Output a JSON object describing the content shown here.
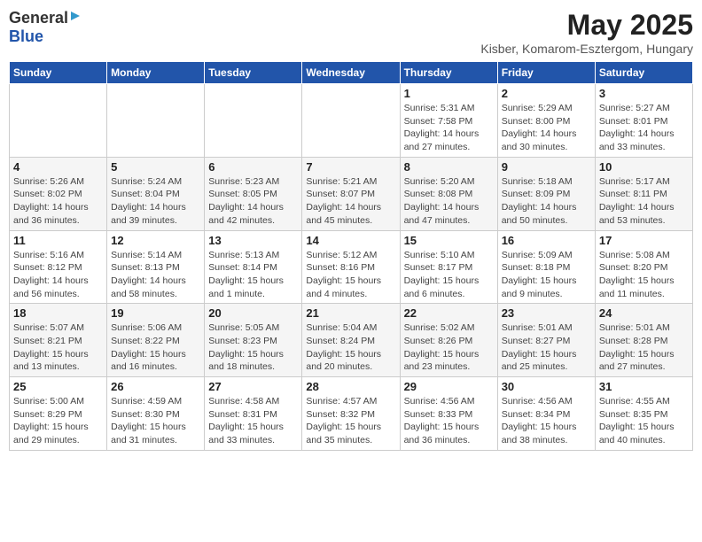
{
  "header": {
    "logo_general": "General",
    "logo_blue": "Blue",
    "title": "May 2025",
    "subtitle": "Kisber, Komarom-Esztergom, Hungary"
  },
  "calendar": {
    "days_of_week": [
      "Sunday",
      "Monday",
      "Tuesday",
      "Wednesday",
      "Thursday",
      "Friday",
      "Saturday"
    ],
    "weeks": [
      [
        {
          "day": "",
          "info": ""
        },
        {
          "day": "",
          "info": ""
        },
        {
          "day": "",
          "info": ""
        },
        {
          "day": "",
          "info": ""
        },
        {
          "day": "1",
          "info": "Sunrise: 5:31 AM\nSunset: 7:58 PM\nDaylight: 14 hours\nand 27 minutes."
        },
        {
          "day": "2",
          "info": "Sunrise: 5:29 AM\nSunset: 8:00 PM\nDaylight: 14 hours\nand 30 minutes."
        },
        {
          "day": "3",
          "info": "Sunrise: 5:27 AM\nSunset: 8:01 PM\nDaylight: 14 hours\nand 33 minutes."
        }
      ],
      [
        {
          "day": "4",
          "info": "Sunrise: 5:26 AM\nSunset: 8:02 PM\nDaylight: 14 hours\nand 36 minutes."
        },
        {
          "day": "5",
          "info": "Sunrise: 5:24 AM\nSunset: 8:04 PM\nDaylight: 14 hours\nand 39 minutes."
        },
        {
          "day": "6",
          "info": "Sunrise: 5:23 AM\nSunset: 8:05 PM\nDaylight: 14 hours\nand 42 minutes."
        },
        {
          "day": "7",
          "info": "Sunrise: 5:21 AM\nSunset: 8:07 PM\nDaylight: 14 hours\nand 45 minutes."
        },
        {
          "day": "8",
          "info": "Sunrise: 5:20 AM\nSunset: 8:08 PM\nDaylight: 14 hours\nand 47 minutes."
        },
        {
          "day": "9",
          "info": "Sunrise: 5:18 AM\nSunset: 8:09 PM\nDaylight: 14 hours\nand 50 minutes."
        },
        {
          "day": "10",
          "info": "Sunrise: 5:17 AM\nSunset: 8:11 PM\nDaylight: 14 hours\nand 53 minutes."
        }
      ],
      [
        {
          "day": "11",
          "info": "Sunrise: 5:16 AM\nSunset: 8:12 PM\nDaylight: 14 hours\nand 56 minutes."
        },
        {
          "day": "12",
          "info": "Sunrise: 5:14 AM\nSunset: 8:13 PM\nDaylight: 14 hours\nand 58 minutes."
        },
        {
          "day": "13",
          "info": "Sunrise: 5:13 AM\nSunset: 8:14 PM\nDaylight: 15 hours\nand 1 minute."
        },
        {
          "day": "14",
          "info": "Sunrise: 5:12 AM\nSunset: 8:16 PM\nDaylight: 15 hours\nand 4 minutes."
        },
        {
          "day": "15",
          "info": "Sunrise: 5:10 AM\nSunset: 8:17 PM\nDaylight: 15 hours\nand 6 minutes."
        },
        {
          "day": "16",
          "info": "Sunrise: 5:09 AM\nSunset: 8:18 PM\nDaylight: 15 hours\nand 9 minutes."
        },
        {
          "day": "17",
          "info": "Sunrise: 5:08 AM\nSunset: 8:20 PM\nDaylight: 15 hours\nand 11 minutes."
        }
      ],
      [
        {
          "day": "18",
          "info": "Sunrise: 5:07 AM\nSunset: 8:21 PM\nDaylight: 15 hours\nand 13 minutes."
        },
        {
          "day": "19",
          "info": "Sunrise: 5:06 AM\nSunset: 8:22 PM\nDaylight: 15 hours\nand 16 minutes."
        },
        {
          "day": "20",
          "info": "Sunrise: 5:05 AM\nSunset: 8:23 PM\nDaylight: 15 hours\nand 18 minutes."
        },
        {
          "day": "21",
          "info": "Sunrise: 5:04 AM\nSunset: 8:24 PM\nDaylight: 15 hours\nand 20 minutes."
        },
        {
          "day": "22",
          "info": "Sunrise: 5:02 AM\nSunset: 8:26 PM\nDaylight: 15 hours\nand 23 minutes."
        },
        {
          "day": "23",
          "info": "Sunrise: 5:01 AM\nSunset: 8:27 PM\nDaylight: 15 hours\nand 25 minutes."
        },
        {
          "day": "24",
          "info": "Sunrise: 5:01 AM\nSunset: 8:28 PM\nDaylight: 15 hours\nand 27 minutes."
        }
      ],
      [
        {
          "day": "25",
          "info": "Sunrise: 5:00 AM\nSunset: 8:29 PM\nDaylight: 15 hours\nand 29 minutes."
        },
        {
          "day": "26",
          "info": "Sunrise: 4:59 AM\nSunset: 8:30 PM\nDaylight: 15 hours\nand 31 minutes."
        },
        {
          "day": "27",
          "info": "Sunrise: 4:58 AM\nSunset: 8:31 PM\nDaylight: 15 hours\nand 33 minutes."
        },
        {
          "day": "28",
          "info": "Sunrise: 4:57 AM\nSunset: 8:32 PM\nDaylight: 15 hours\nand 35 minutes."
        },
        {
          "day": "29",
          "info": "Sunrise: 4:56 AM\nSunset: 8:33 PM\nDaylight: 15 hours\nand 36 minutes."
        },
        {
          "day": "30",
          "info": "Sunrise: 4:56 AM\nSunset: 8:34 PM\nDaylight: 15 hours\nand 38 minutes."
        },
        {
          "day": "31",
          "info": "Sunrise: 4:55 AM\nSunset: 8:35 PM\nDaylight: 15 hours\nand 40 minutes."
        }
      ]
    ]
  }
}
